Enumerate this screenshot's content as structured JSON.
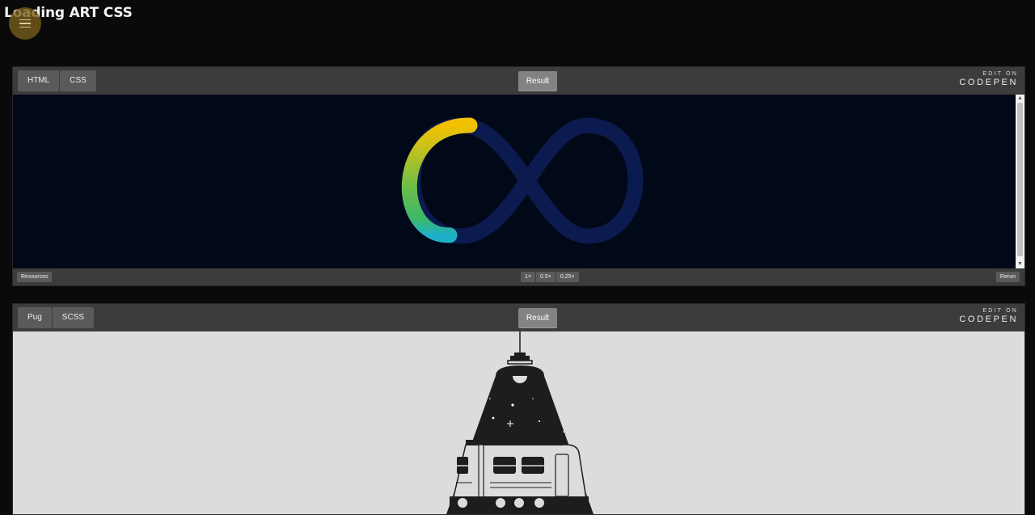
{
  "page": {
    "title": "Loading ART CSS"
  },
  "embeds": [
    {
      "tabs": [
        "HTML",
        "CSS"
      ],
      "result_label": "Result",
      "edit_on": "EDIT ON",
      "brand": "CODEPEN",
      "footer": {
        "resources_label": "Resources",
        "zoom_options": [
          "1×",
          "0.5×",
          "0.25×"
        ],
        "rerun_label": "Rerun"
      },
      "preview": {
        "background": "#010818",
        "track_color": "#0c1b4f",
        "gradient": [
          "#f3c100",
          "#7bc043",
          "#1fb0c9"
        ]
      }
    },
    {
      "tabs": [
        "Pug",
        "SCSS"
      ],
      "result_label": "Result",
      "edit_on": "EDIT ON",
      "brand": "CODEPEN",
      "preview": {
        "background": "#dcdcdd",
        "ink": "#1d1d1f"
      }
    }
  ]
}
